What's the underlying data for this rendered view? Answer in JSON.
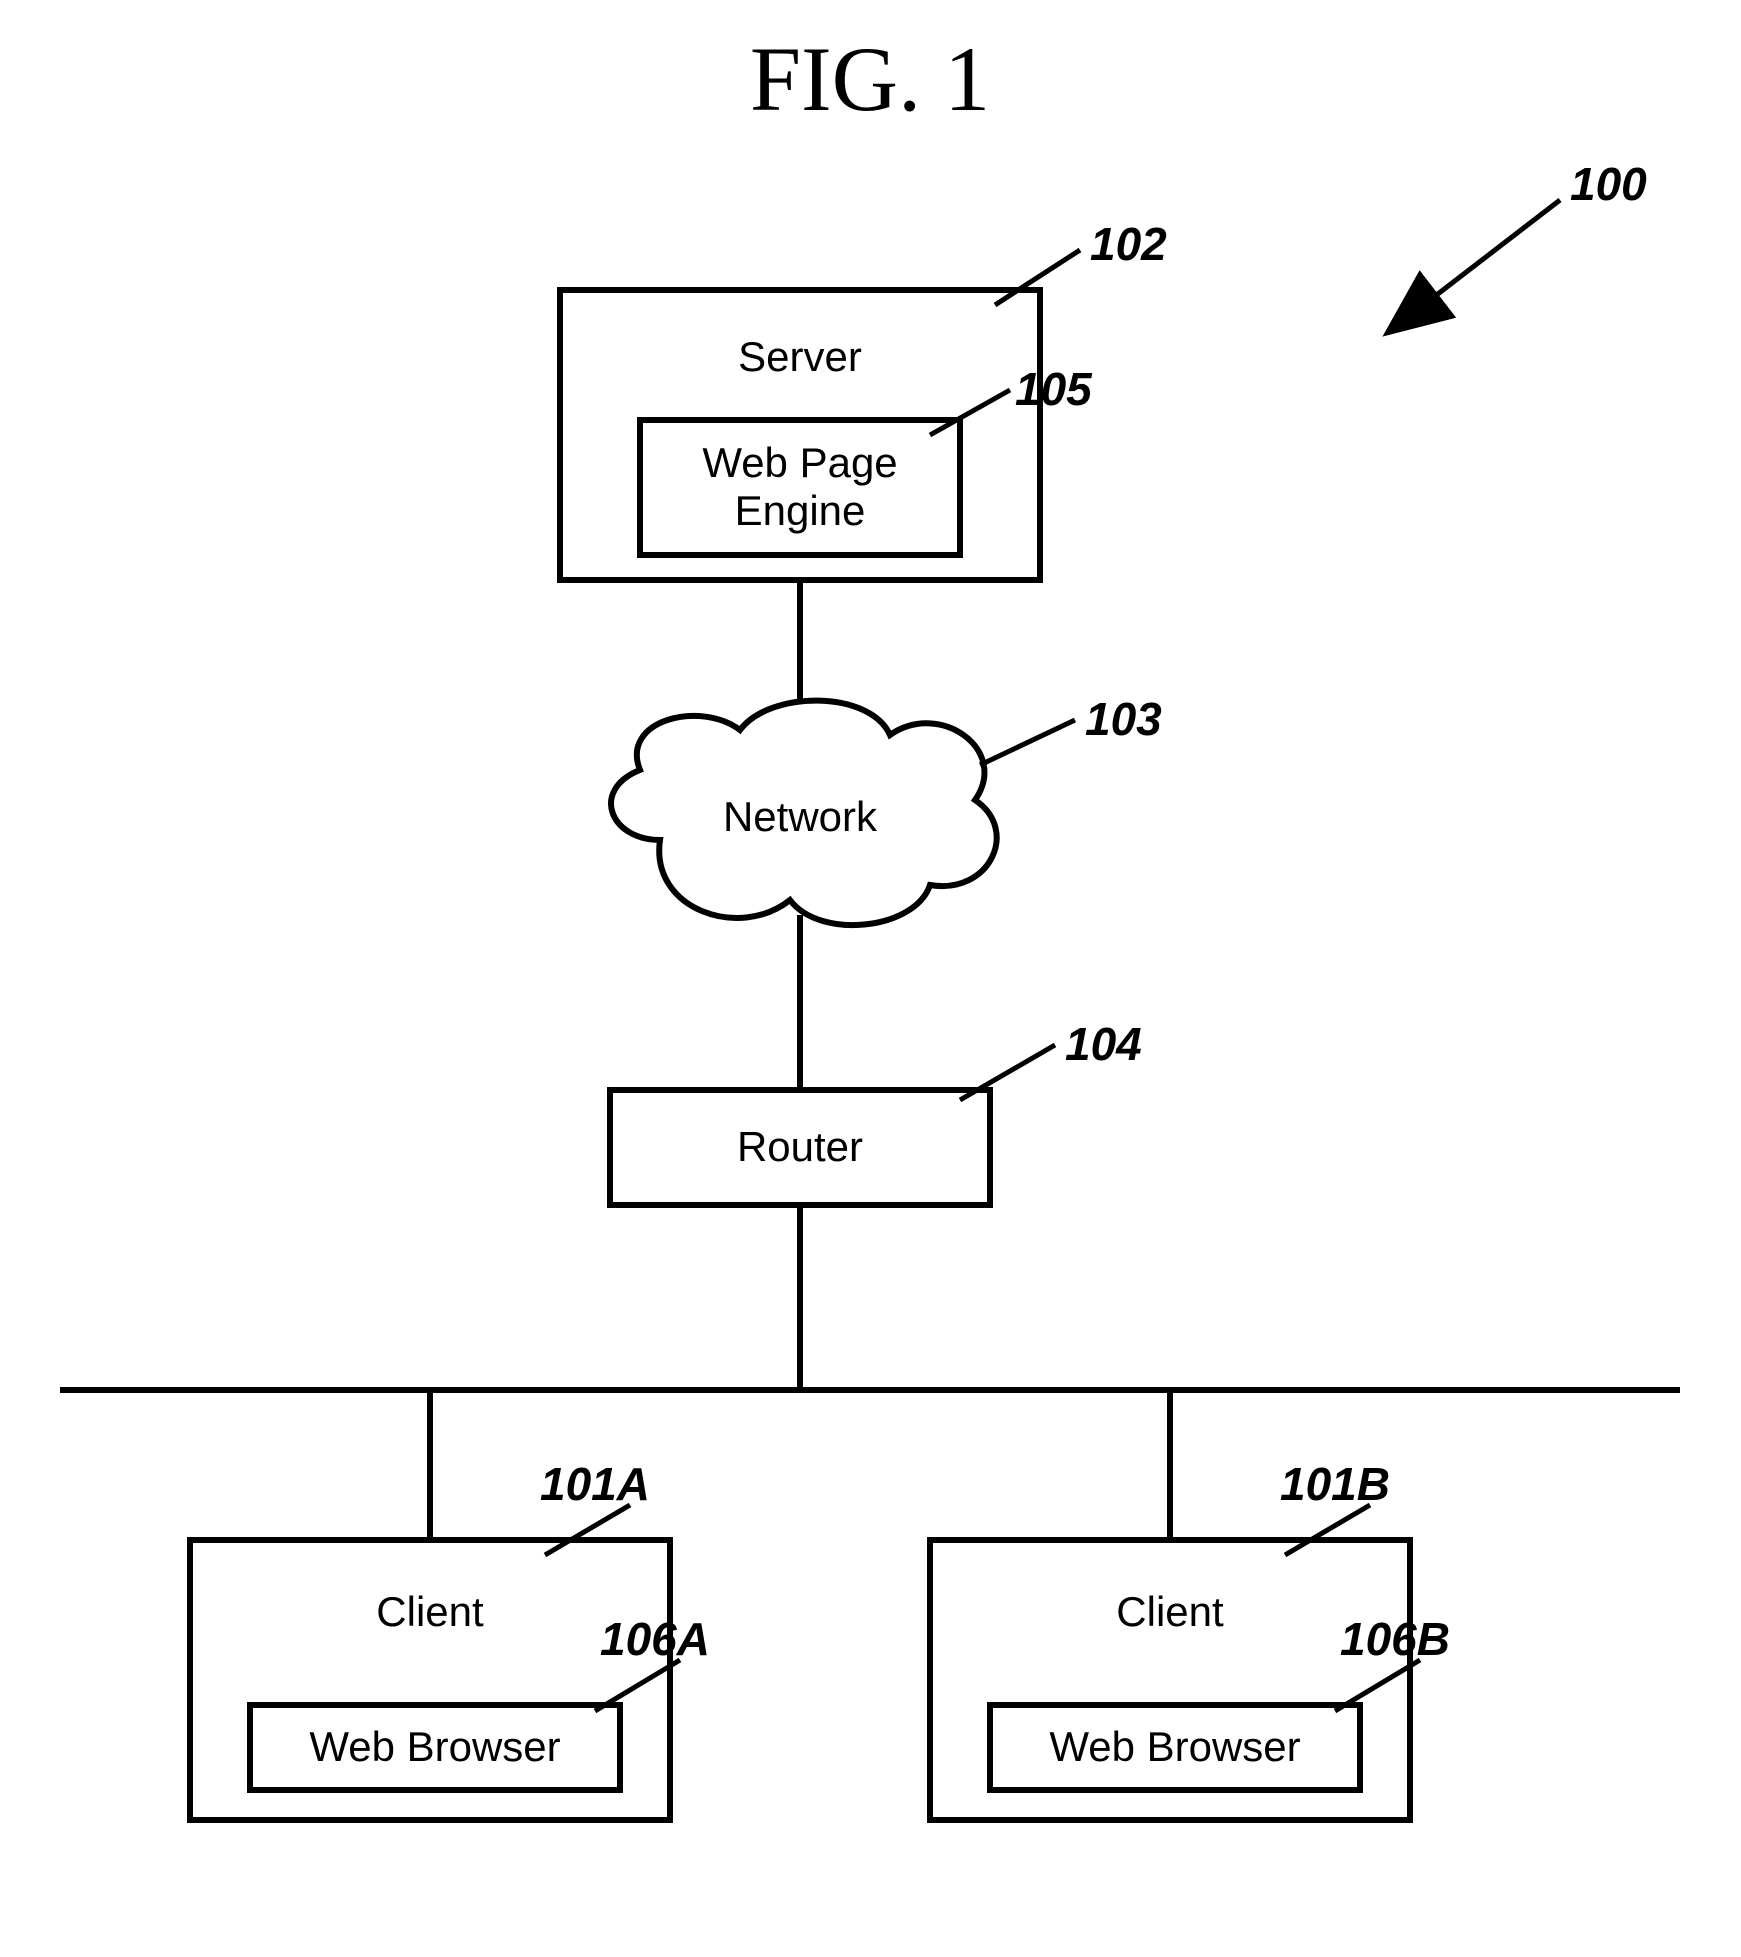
{
  "figure": {
    "title": "FIG. 1",
    "ref_overall": "100",
    "nodes": {
      "server": {
        "label": "Server",
        "ref": "102"
      },
      "web_page_engine": {
        "label": "Web Page\nEngine",
        "ref": "105"
      },
      "network": {
        "label": "Network",
        "ref": "103"
      },
      "router": {
        "label": "Router",
        "ref": "104"
      },
      "client_a": {
        "label": "Client",
        "ref": "101A"
      },
      "browser_a": {
        "label": "Web Browser",
        "ref": "106A"
      },
      "client_b": {
        "label": "Client",
        "ref": "101B"
      },
      "browser_b": {
        "label": "Web Browser",
        "ref": "106B"
      }
    }
  }
}
